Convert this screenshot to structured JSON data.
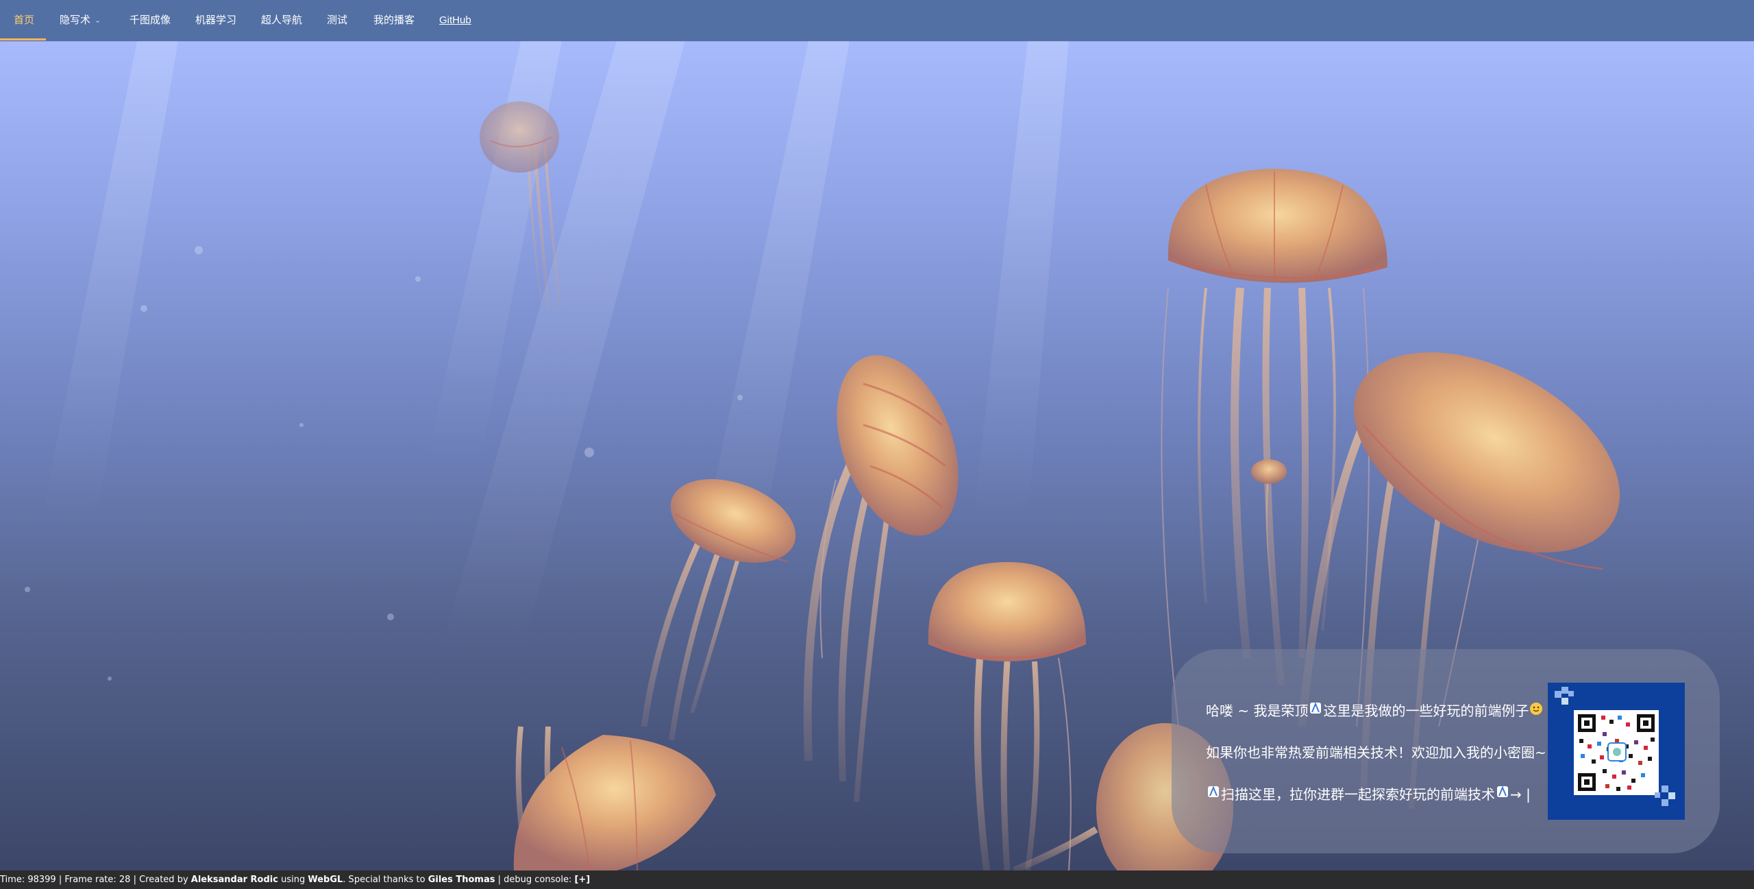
{
  "nav": {
    "items": [
      {
        "label": "首页",
        "active": true
      },
      {
        "label": "隐写术",
        "dropdown": true
      },
      {
        "label": "千图成像"
      },
      {
        "label": "机器学习"
      },
      {
        "label": "超人导航"
      },
      {
        "label": "测试"
      },
      {
        "label": "我的播客"
      },
      {
        "label": "GitHub"
      }
    ],
    "caret_icon": "chevron-down-icon"
  },
  "promo": {
    "line1_a": "哈喽 ~ 我是荣顶",
    "line1_b": "这里是我做的一些好玩的前端例子",
    "line2": "如果你也非常热爱前端相关技术！欢迎加入我的小密圈~",
    "line3_a": "扫描这里，拉你进群一起探索好玩的前端技术",
    "line3_b": "→ |",
    "icons": [
      "unicorn-icon",
      "smile-icon",
      "qr-code-icon"
    ]
  },
  "footer": {
    "time_label": "Time: 98399",
    "sep1": " | ",
    "framerate_label": "Frame rate: 28",
    "sep2": " | ",
    "created_by_prefix": "Created by ",
    "author": "Aleksandar Rodic",
    "using_text": " using ",
    "tech": "WebGL",
    "thanks_text": ". Special thanks to ",
    "thanks_name": "Giles Thomas",
    "sep3": " | ",
    "debug_label": "debug console: ",
    "debug_toggle": "[+]"
  },
  "colors": {
    "nav_bg": "#5270a4",
    "nav_active": "#ffcf6e",
    "accent_underline": "#f3b45b",
    "footer_bg": "#2c2b2d",
    "qr_bg": "#0d3f9d"
  }
}
